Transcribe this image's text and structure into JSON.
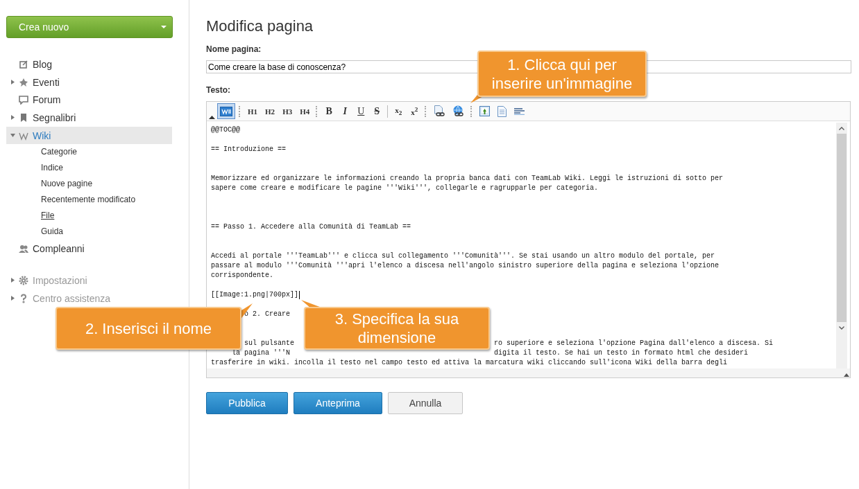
{
  "sidebar": {
    "create_button": {
      "label": "Crea nuovo"
    },
    "items": [
      {
        "label": "Blog",
        "expandable": false,
        "selected": false
      },
      {
        "label": "Eventi",
        "expandable": true,
        "expanded": false,
        "selected": false
      },
      {
        "label": "Forum",
        "expandable": false,
        "selected": false
      },
      {
        "label": "Segnalibri",
        "expandable": true,
        "expanded": false,
        "selected": false
      },
      {
        "label": "Wiki",
        "expandable": true,
        "expanded": true,
        "selected": true,
        "children": [
          {
            "label": "Categorie",
            "hovered": false
          },
          {
            "label": "Indice",
            "hovered": false
          },
          {
            "label": "Nuove pagine",
            "hovered": false
          },
          {
            "label": "Recentemente modificato",
            "hovered": false
          },
          {
            "label": "File",
            "hovered": true
          },
          {
            "label": "Guida",
            "hovered": false
          }
        ]
      },
      {
        "label": "Compleanni",
        "expandable": false,
        "selected": false
      }
    ],
    "footer_items": [
      {
        "label": "Impostazioni",
        "expandable": true,
        "expanded": false
      },
      {
        "label": "Centro assistenza",
        "expandable": true,
        "expanded": false
      }
    ]
  },
  "page": {
    "title": "Modifica pagina",
    "name_label": "Nome pagina:",
    "name_value": "Come creare la base di conoscenza?",
    "text_label": "Testo:",
    "toolbar": [
      {
        "kind": "wiki",
        "selected": true
      },
      {
        "kind": "sep"
      },
      {
        "kind": "text",
        "label": "H1"
      },
      {
        "kind": "text",
        "label": "H2"
      },
      {
        "kind": "text",
        "label": "H3"
      },
      {
        "kind": "text",
        "label": "H4"
      },
      {
        "kind": "sep"
      },
      {
        "kind": "bold",
        "label": "B"
      },
      {
        "kind": "italic",
        "label": "I"
      },
      {
        "kind": "underline",
        "label": "U"
      },
      {
        "kind": "strike",
        "label": "S"
      },
      {
        "kind": "bar"
      },
      {
        "kind": "text",
        "label": "x$_{2}$"
      },
      {
        "kind": "text",
        "label": "x$^{2}$"
      },
      {
        "kind": "sep"
      },
      {
        "kind": "link"
      },
      {
        "kind": "globe"
      },
      {
        "kind": "sep"
      },
      {
        "kind": "image"
      },
      {
        "kind": "page"
      },
      {
        "kind": "lines"
      }
    ],
    "lines": [
      {
        "segments": [
          "@@TOC@@"
        ]
      },
      {
        "segments": [
          "== Introduzione =="
        ]
      },
      {
        "segments": [
          "Memorizzare ed organizzare le informazioni creando la propria banca dati con TeamLab Wiki. Leggi le istruzioni di sotto per"
        ]
      },
      {
        "segments": [
          "sapere come creare e modificare le pagine '''Wiki''', collegarle e ragrupparle per categoria."
        ]
      },
      {
        "segments": [
          "== Passo 1. Accedere alla Comunità di TeamLab =="
        ]
      },
      {
        "segments": [
          "Accedi al portale '''TeamLab''' e clicca sul collegamento '''Comunità'''. Se stai usando un altro modulo del portale, per"
        ]
      },
      {
        "segments": [
          "passare al modulo '''Comunità '''apri l'elenco a discesa nell'angolo sinistro superiore della pagina e seleziona l'opzione"
        ]
      },
      {
        "segments": [
          "corrispondente."
        ]
      },
      {
        "segments": [
          "[[Image:1.png|700px]]"
        ],
        "cursor": true
      },
      {
        "segments": [
          "o 2. Creare"
        ]
      },
      {
        "segments": [
          "sul pulsante",
          "ro superiore e seleziona l'opzione Pagina dall'elenco a discesa. Si"
        ]
      },
      {
        "segments": [
          "la pagina '''N",
          "digita il testo. Se hai un testo in formato html che desideri"
        ]
      },
      {
        "segments": [
          "trasferire in wiki. incolla il testo nel campo testo ed attiva la marcatura wiki cliccando sull'icona Wiki della barra degli"
        ]
      }
    ],
    "buttons": [
      {
        "label": "Pubblica",
        "kind": "primary"
      },
      {
        "label": "Anteprima",
        "kind": "primary"
      },
      {
        "label": "Annulla",
        "kind": "secondary"
      }
    ]
  },
  "callouts": [
    {
      "text": "1. Clicca qui per inserire un'immagine"
    },
    {
      "text": "2. Inserisci il nome"
    },
    {
      "text": "3. Specifica la sua dimensione"
    }
  ]
}
